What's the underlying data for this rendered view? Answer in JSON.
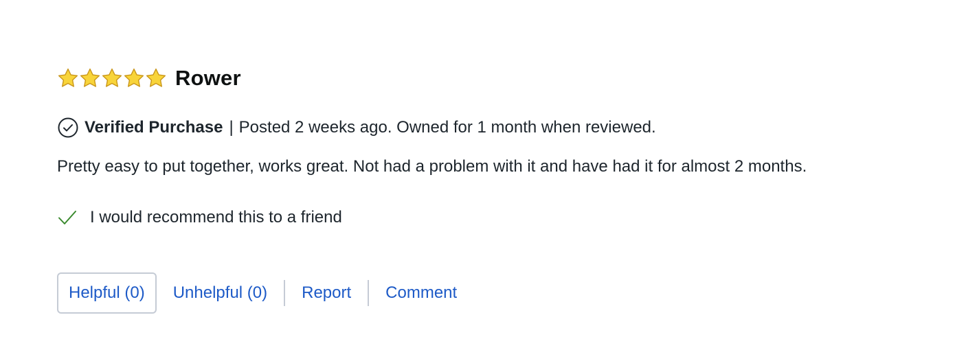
{
  "review": {
    "rating": 5,
    "rating_max": 5,
    "star_color": "#f8d43a",
    "title": "Rower",
    "verified_label": "Verified Purchase",
    "separator": "|",
    "posted_text": "Posted 2 weeks ago. Owned for 1 month when reviewed.",
    "body": "Pretty easy to put together, works great. Not had a problem with it and have had it for almost 2 months.",
    "recommend_text": "I would recommend this to a friend",
    "recommend_icon": "check-icon",
    "verified_icon": "check-circle-icon"
  },
  "actions": {
    "helpful_label": "Helpful (0)",
    "unhelpful_label": "Unhelpful (0)",
    "report_label": "Report",
    "comment_label": "Comment",
    "link_color": "#1d5ac7"
  }
}
